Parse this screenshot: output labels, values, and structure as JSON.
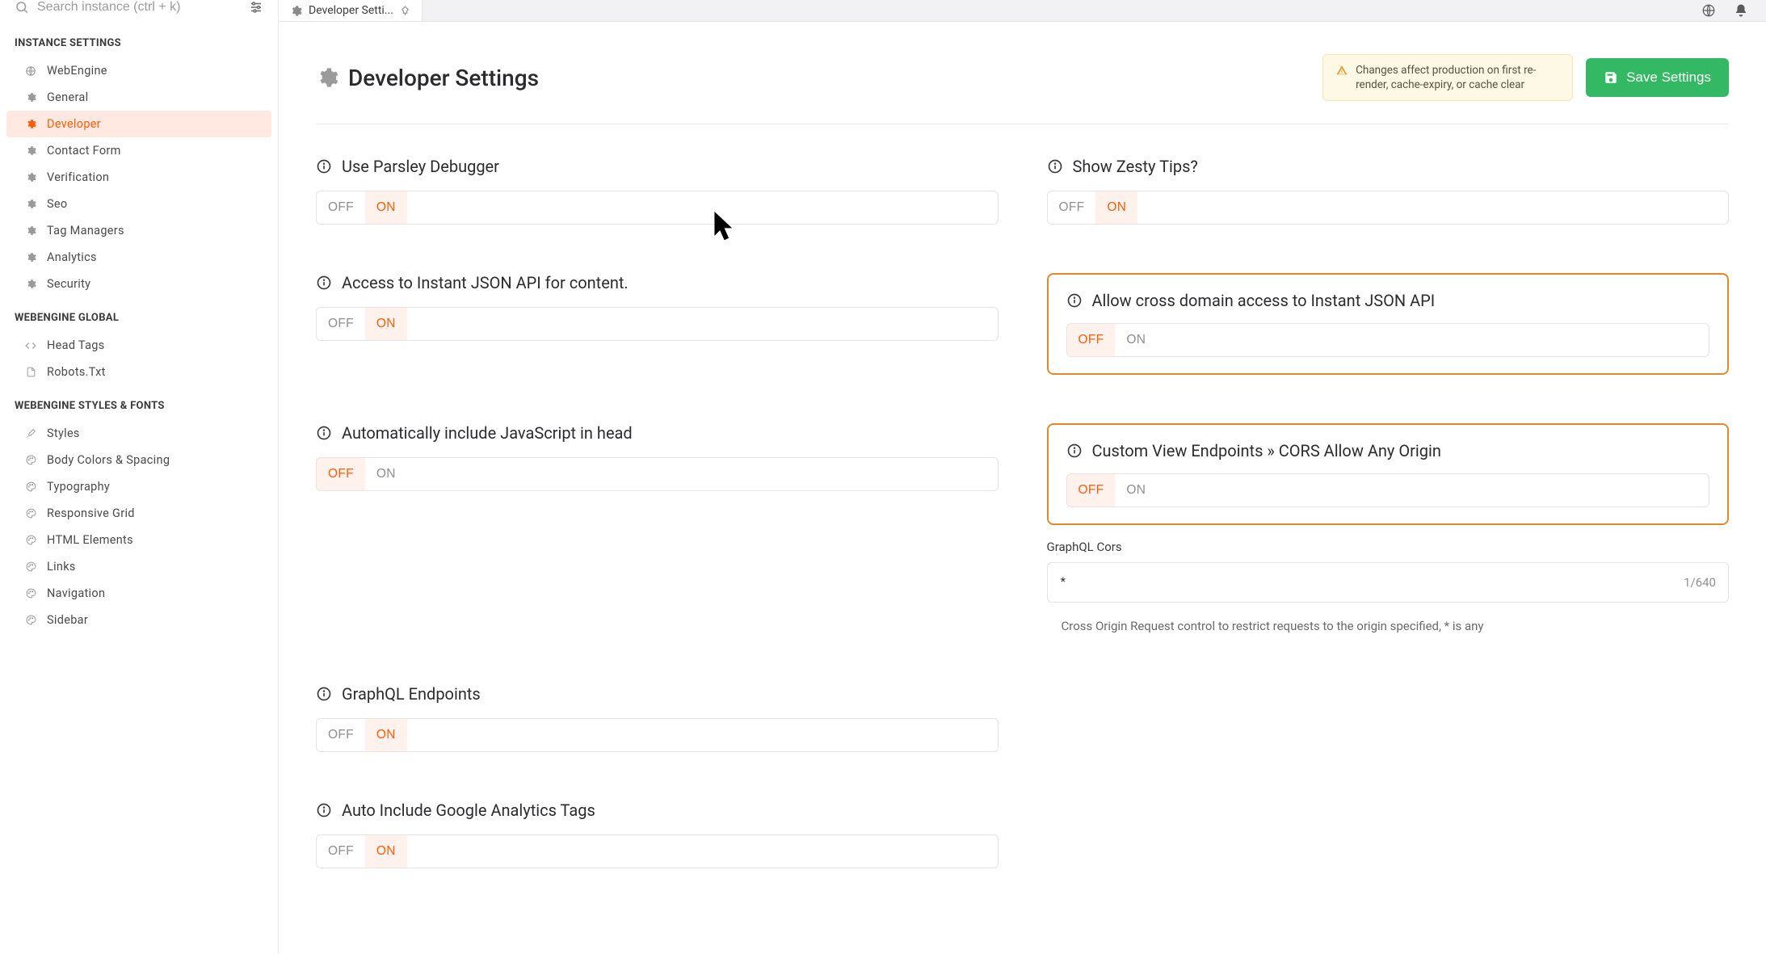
{
  "search": {
    "placeholder": "Search instance (ctrl + k)"
  },
  "tab": {
    "label": "Developer Setti..."
  },
  "page": {
    "title": "Developer Settings",
    "alert": "Changes affect production on first re-render, cache-expiry, or cache clear",
    "save": "Save Settings"
  },
  "toggle_labels": {
    "off": "OFF",
    "on": "ON"
  },
  "sidebar": {
    "sections": [
      {
        "title": "INSTANCE SETTINGS",
        "items": [
          {
            "label": "WebEngine",
            "icon": "globe"
          },
          {
            "label": "General",
            "icon": "gear"
          },
          {
            "label": "Developer",
            "icon": "gear",
            "active": true
          },
          {
            "label": "Contact Form",
            "icon": "gear"
          },
          {
            "label": "Verification",
            "icon": "gear"
          },
          {
            "label": "Seo",
            "icon": "gear"
          },
          {
            "label": "Tag Managers",
            "icon": "gear"
          },
          {
            "label": "Analytics",
            "icon": "gear"
          },
          {
            "label": "Security",
            "icon": "gear"
          }
        ]
      },
      {
        "title": "WEBENGINE GLOBAL",
        "items": [
          {
            "label": "Head Tags",
            "icon": "code"
          },
          {
            "label": "Robots.Txt",
            "icon": "file"
          }
        ]
      },
      {
        "title": "WEBENGINE STYLES & FONTS",
        "items": [
          {
            "label": "Styles",
            "icon": "brush"
          },
          {
            "label": "Body Colors & Spacing",
            "icon": "palette"
          },
          {
            "label": "Typography",
            "icon": "palette"
          },
          {
            "label": "Responsive Grid",
            "icon": "palette"
          },
          {
            "label": "HTML Elements",
            "icon": "palette"
          },
          {
            "label": "Links",
            "icon": "palette"
          },
          {
            "label": "Navigation",
            "icon": "palette"
          },
          {
            "label": "Sidebar",
            "icon": "palette"
          }
        ]
      }
    ]
  },
  "settings": {
    "parsley": {
      "label": "Use Parsley Debugger",
      "value": "on"
    },
    "tips": {
      "label": "Show Zesty Tips?",
      "value": "on"
    },
    "instant": {
      "label": "Access to Instant JSON API for content.",
      "value": "on"
    },
    "cors_instant": {
      "label": "Allow cross domain access to Instant JSON API",
      "value": "off",
      "highlighted": true
    },
    "auto_js": {
      "label": "Automatically include JavaScript in head",
      "value": "off"
    },
    "cors_view": {
      "label": "Custom View Endpoints » CORS Allow Any Origin",
      "value": "off",
      "highlighted": true
    },
    "graphql": {
      "label": "GraphQL Endpoints",
      "value": "on"
    },
    "graphql_cors": {
      "label": "GraphQL Cors",
      "value": "*",
      "counter": "1/640",
      "help": "Cross Origin Request control to restrict requests to the origin specified, * is any"
    },
    "ga": {
      "label": "Auto Include Google Analytics Tags",
      "value": "on"
    }
  }
}
